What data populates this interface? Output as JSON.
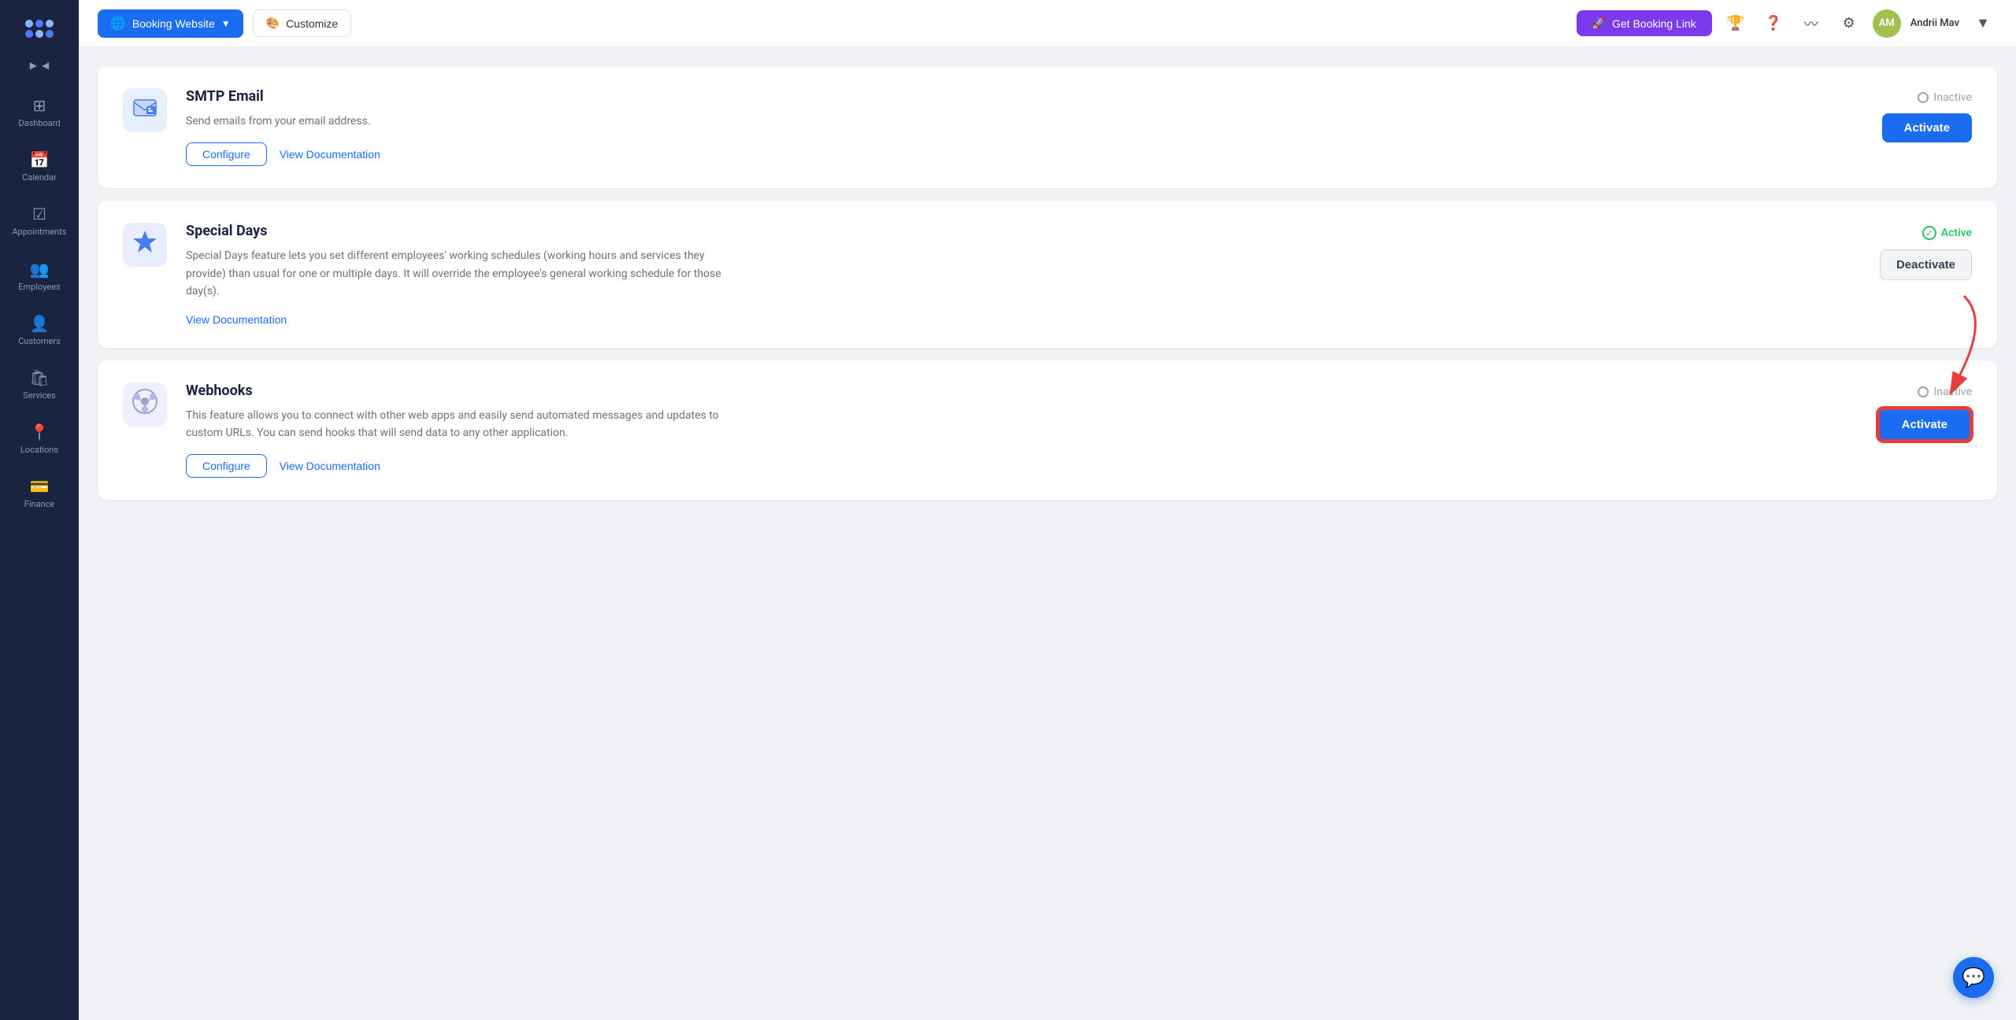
{
  "sidebar": {
    "logo_alt": "App Logo",
    "items": [
      {
        "id": "dashboard",
        "label": "Dashboard",
        "icon": "⊞"
      },
      {
        "id": "calendar",
        "label": "Calendar",
        "icon": "📅"
      },
      {
        "id": "appointments",
        "label": "Appointments",
        "icon": "✔"
      },
      {
        "id": "employees",
        "label": "Employees",
        "icon": "👥"
      },
      {
        "id": "customers",
        "label": "Customers",
        "icon": "👤"
      },
      {
        "id": "services",
        "label": "Services",
        "icon": "🛍"
      },
      {
        "id": "locations",
        "label": "Locations",
        "icon": "📍"
      },
      {
        "id": "finance",
        "label": "Finance",
        "icon": "💳"
      }
    ]
  },
  "topbar": {
    "booking_website_label": "Booking Website",
    "customize_label": "Customize",
    "get_booking_link_label": "Get Booking Link",
    "user_initials": "AM",
    "user_name": "Andrii Mav"
  },
  "features": [
    {
      "id": "smtp-email",
      "title": "SMTP Email",
      "description": "Send emails from your email address.",
      "status": "inactive",
      "status_label": "Inactive",
      "has_configure": true,
      "configure_label": "Configure",
      "view_docs_label": "View Documentation",
      "activate_label": "Activate",
      "icon": "📬",
      "icon_type": "smtp"
    },
    {
      "id": "special-days",
      "title": "Special Days",
      "description": "Special Days feature lets you set different employees' working schedules (working hours and services they provide) than usual for one or multiple days. It will override the employee's general working schedule for those day(s).",
      "status": "active",
      "status_label": "Active",
      "has_configure": false,
      "view_docs_label": "View Documentation",
      "deactivate_label": "Deactivate",
      "icon": "⭐",
      "icon_type": "special-days"
    },
    {
      "id": "webhooks",
      "title": "Webhooks",
      "description": "This feature allows you to connect with other web apps and easily send automated messages and updates to custom URLs. You can send hooks that will send data to any other application.",
      "status": "inactive",
      "status_label": "Inactive",
      "has_configure": true,
      "configure_label": "Configure",
      "view_docs_label": "View Documentation",
      "activate_label": "Activate",
      "icon": "🔗",
      "icon_type": "webhooks",
      "highlighted": true
    }
  ],
  "chat_button_title": "Open chat"
}
